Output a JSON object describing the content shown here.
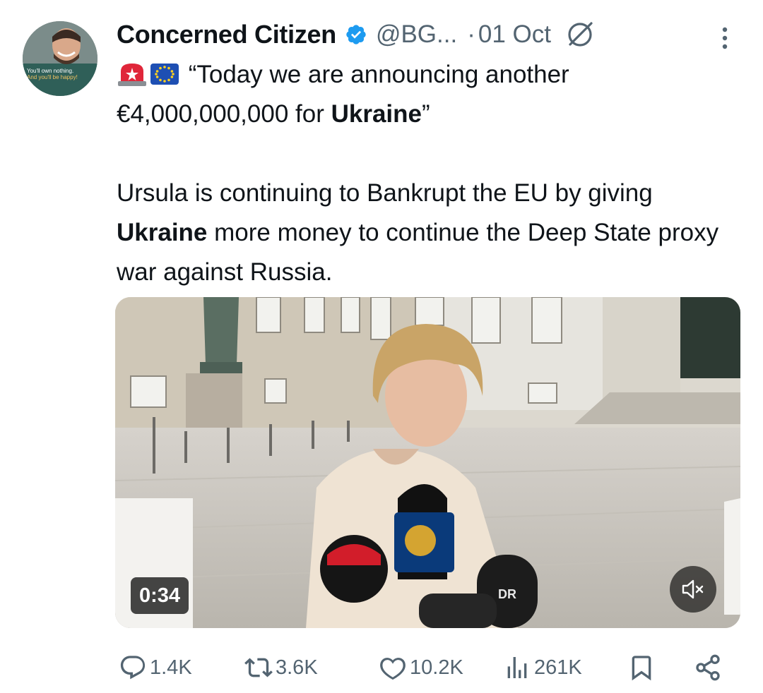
{
  "tweet": {
    "author_name": "Concerned Citizen",
    "handle": "@BG...",
    "separator": "·",
    "date": "01 Oct",
    "avatar_caption_line1": "You'll own nothing.",
    "avatar_caption_line2": "And you'll be happy!",
    "quote_open": "“Today we are announcing another €4,000,000,000 for ",
    "quote_bold": "Ukraine",
    "quote_close": "”",
    "para2_before": "Ursula is continuing to Bankrupt the EU by giving ",
    "para2_bold": "Ukraine",
    "para2_after": " more money to continue the Deep State proxy war against Russia."
  },
  "media": {
    "duration": "0:34",
    "mic_labels": [
      "DR"
    ]
  },
  "actions": {
    "replies": "1.4K",
    "reposts": "3.6K",
    "likes": "10.2K",
    "views": "261K"
  },
  "icons": {
    "verified": "verified-badge-icon",
    "grok": "grok-icon",
    "more": "more-vertical-icon",
    "siren": "siren-emoji-icon",
    "eu_flag": "eu-flag-icon",
    "mute": "muted-speaker-icon",
    "reply": "reply-icon",
    "repost": "repost-icon",
    "like": "heart-icon",
    "views": "views-chart-icon",
    "bookmark": "bookmark-icon",
    "share": "share-icon"
  },
  "colors": {
    "text_primary": "#0f1419",
    "text_secondary": "#536471",
    "verified_blue": "#1d9bf0"
  }
}
